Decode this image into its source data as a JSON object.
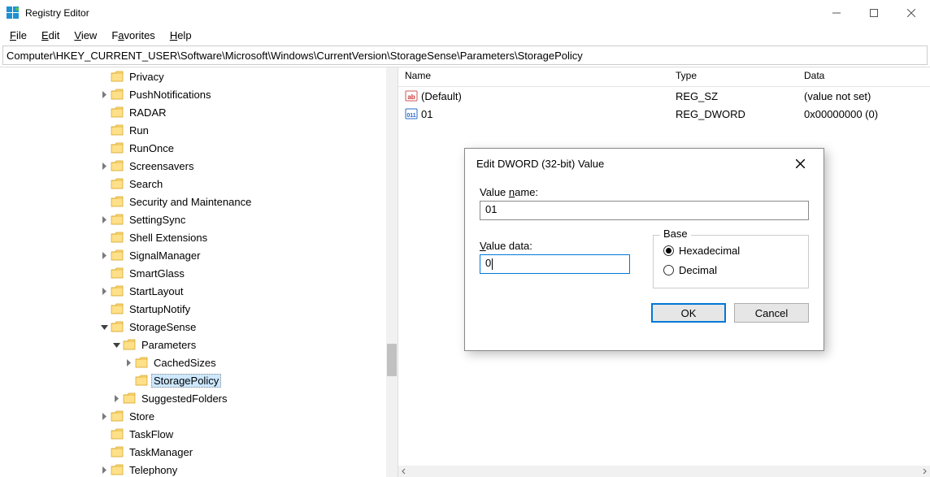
{
  "window": {
    "title": "Registry Editor"
  },
  "menu": {
    "file": "File",
    "edit": "Edit",
    "view": "View",
    "favorites": "Favorites",
    "help": "Help"
  },
  "address": "Computer\\HKEY_CURRENT_USER\\Software\\Microsoft\\Windows\\CurrentVersion\\StorageSense\\Parameters\\StoragePolicy",
  "tree_items": [
    {
      "indent": 9,
      "expander": "",
      "label": "Privacy"
    },
    {
      "indent": 9,
      "expander": "closed",
      "label": "PushNotifications"
    },
    {
      "indent": 9,
      "expander": "",
      "label": "RADAR"
    },
    {
      "indent": 9,
      "expander": "",
      "label": "Run"
    },
    {
      "indent": 9,
      "expander": "",
      "label": "RunOnce"
    },
    {
      "indent": 9,
      "expander": "closed",
      "label": "Screensavers"
    },
    {
      "indent": 9,
      "expander": "",
      "label": "Search"
    },
    {
      "indent": 9,
      "expander": "",
      "label": "Security and Maintenance"
    },
    {
      "indent": 9,
      "expander": "closed",
      "label": "SettingSync"
    },
    {
      "indent": 9,
      "expander": "",
      "label": "Shell Extensions"
    },
    {
      "indent": 9,
      "expander": "closed",
      "label": "SignalManager"
    },
    {
      "indent": 9,
      "expander": "",
      "label": "SmartGlass"
    },
    {
      "indent": 9,
      "expander": "closed",
      "label": "StartLayout"
    },
    {
      "indent": 9,
      "expander": "",
      "label": "StartupNotify"
    },
    {
      "indent": 9,
      "expander": "open",
      "label": "StorageSense"
    },
    {
      "indent": 10,
      "expander": "open",
      "label": "Parameters"
    },
    {
      "indent": 11,
      "expander": "closed",
      "label": "CachedSizes"
    },
    {
      "indent": 11,
      "expander": "",
      "label": "StoragePolicy",
      "selected": true
    },
    {
      "indent": 10,
      "expander": "closed",
      "label": "SuggestedFolders"
    },
    {
      "indent": 9,
      "expander": "closed",
      "label": "Store"
    },
    {
      "indent": 9,
      "expander": "",
      "label": "TaskFlow"
    },
    {
      "indent": 9,
      "expander": "",
      "label": "TaskManager"
    },
    {
      "indent": 9,
      "expander": "closed",
      "label": "Telephony"
    }
  ],
  "list": {
    "columns": {
      "name": "Name",
      "type": "Type",
      "data": "Data"
    },
    "rows": [
      {
        "icon": "sz",
        "name": "(Default)",
        "type": "REG_SZ",
        "data": "(value not set)"
      },
      {
        "icon": "dword",
        "name": "01",
        "type": "REG_DWORD",
        "data": "0x00000000 (0)"
      }
    ]
  },
  "dialog": {
    "title": "Edit DWORD (32-bit) Value",
    "value_name_label": "Value name:",
    "value_name": "01",
    "value_data_label": "Value data:",
    "value_data": "0",
    "base_label": "Base",
    "hex_label": "Hexadecimal",
    "dec_label": "Decimal",
    "ok": "OK",
    "cancel": "Cancel"
  }
}
